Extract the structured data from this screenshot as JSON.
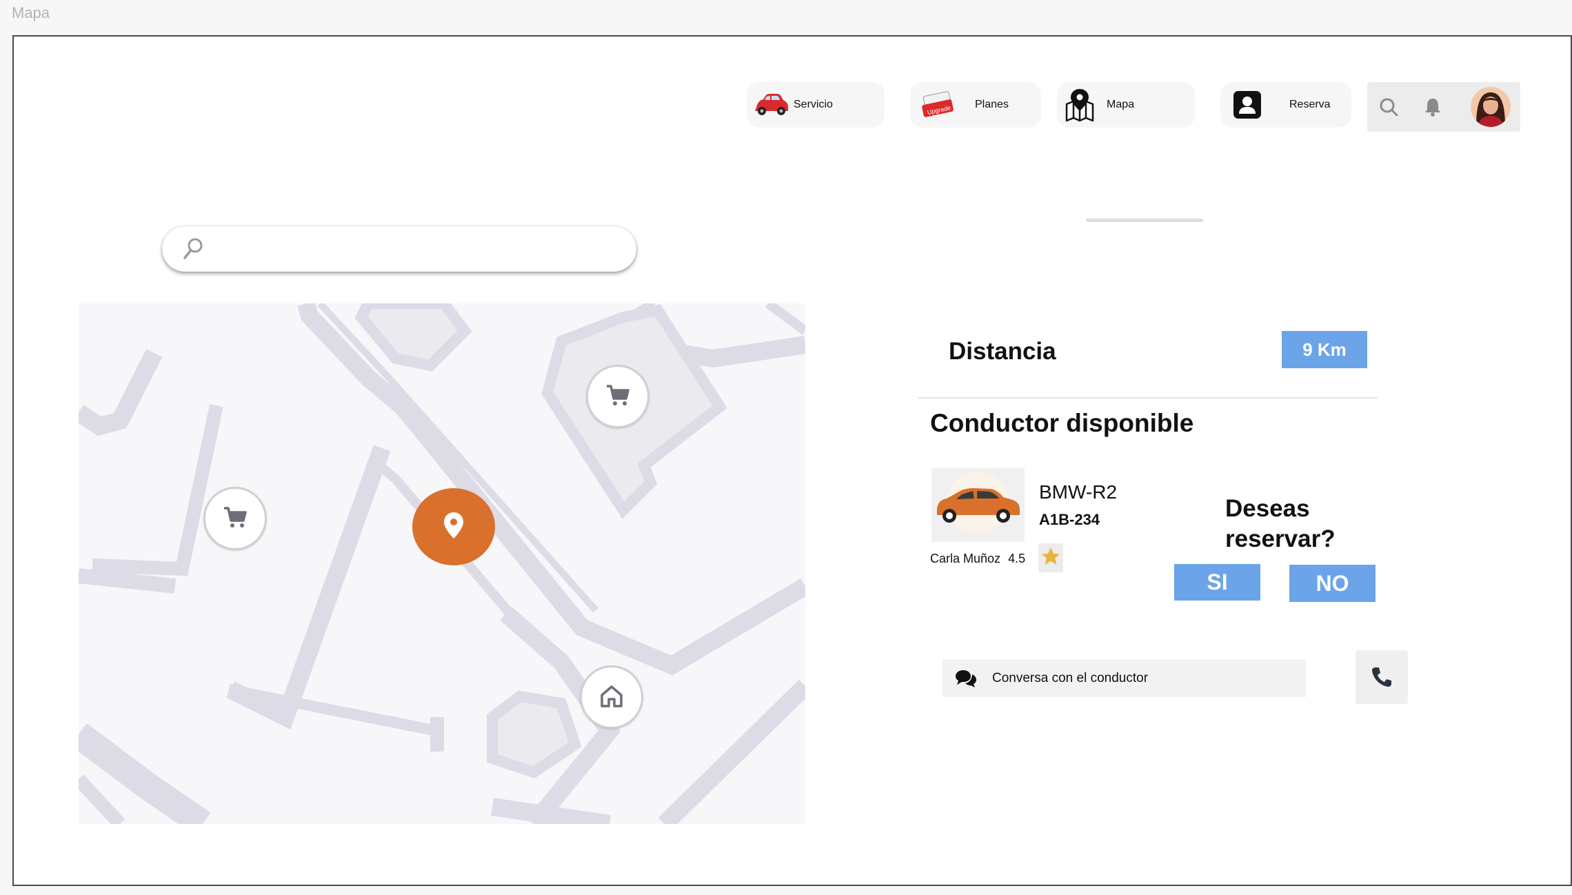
{
  "frame": {
    "title": "Mapa"
  },
  "nav": {
    "items": [
      {
        "label": "Servicio",
        "icon": "red-car-icon"
      },
      {
        "label": "Planes",
        "icon": "upgrade-ticket-icon"
      },
      {
        "label": "Mapa",
        "icon": "map-pin-icon"
      },
      {
        "label": "Reserva",
        "icon": "contact-card-icon"
      }
    ],
    "actions": [
      "search-icon",
      "bell-icon",
      "avatar"
    ]
  },
  "search": {
    "placeholder": "",
    "value": ""
  },
  "map": {
    "markers": [
      {
        "type": "cart",
        "icon": "cart-icon"
      },
      {
        "type": "cart",
        "icon": "cart-icon"
      },
      {
        "type": "current-location",
        "icon": "location-pin-icon"
      },
      {
        "type": "home",
        "icon": "home-icon"
      }
    ]
  },
  "trip": {
    "distance_label": "Distancia",
    "distance_value": "9 Km"
  },
  "driver": {
    "section_title": "Conductor disponible",
    "car_model": "BMW-R2",
    "plate": "A1B-234",
    "name": "Carla Muñoz",
    "rating": "4.5"
  },
  "reserve": {
    "question": "Deseas reservar?",
    "yes_label": "SI",
    "no_label": "NO"
  },
  "chat": {
    "label": "Conversa con el conductor"
  },
  "colors": {
    "accent_blue": "#6ba4e8",
    "location_orange": "#d9702b",
    "star_gold": "#e7b43c"
  }
}
